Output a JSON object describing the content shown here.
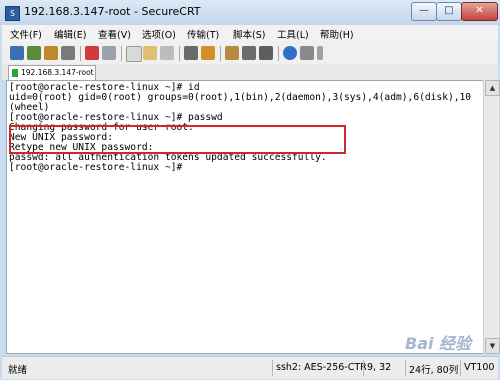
{
  "window": {
    "title": "192.168.3.147-root - SecureCRT",
    "app_icon_text": "S",
    "buttons": {
      "minimize": "—",
      "maximize": "□",
      "close": "✕"
    }
  },
  "menu": [
    "文件(F)",
    "编辑(E)",
    "查看(V)",
    "选项(O)",
    "传输(T)",
    "脚本(S)",
    "工具(L)",
    "帮助(H)"
  ],
  "toolbar_icons": [
    "connect-icon",
    "quick-connect-icon",
    "connect-tab-icon",
    "session-options-icon",
    "reconnect-icon",
    "disconnect-icon",
    "copy-icon",
    "paste-icon",
    "find-icon",
    "print-icon",
    "log-icon",
    "sftp-icon",
    "settings-icon",
    "keymap-icon",
    "help-icon",
    "about-icon",
    "more-icon"
  ],
  "tab": {
    "label": "192.168.3.147-root"
  },
  "terminal": {
    "lines": [
      "[root@oracle-restore-linux ~]# id",
      "uid=0(root) gid=0(root) groups=0(root),1(bin),2(daemon),3(sys),4(adm),6(disk),10",
      "(wheel)",
      "[root@oracle-restore-linux ~]# passwd",
      "Changing password for user root.",
      "New UNIX password:",
      "Retype new UNIX password:",
      "passwd: all authentication tokens updated successfully.",
      "[root@oracle-restore-linux ~]#"
    ]
  },
  "status": {
    "ready": "就绪",
    "connection": "ssh2: AES-256-CTR",
    "cursor": "9,  32",
    "size": "24行, 80列",
    "terminal_type": "VT100"
  },
  "watermark": "Bai 经验"
}
